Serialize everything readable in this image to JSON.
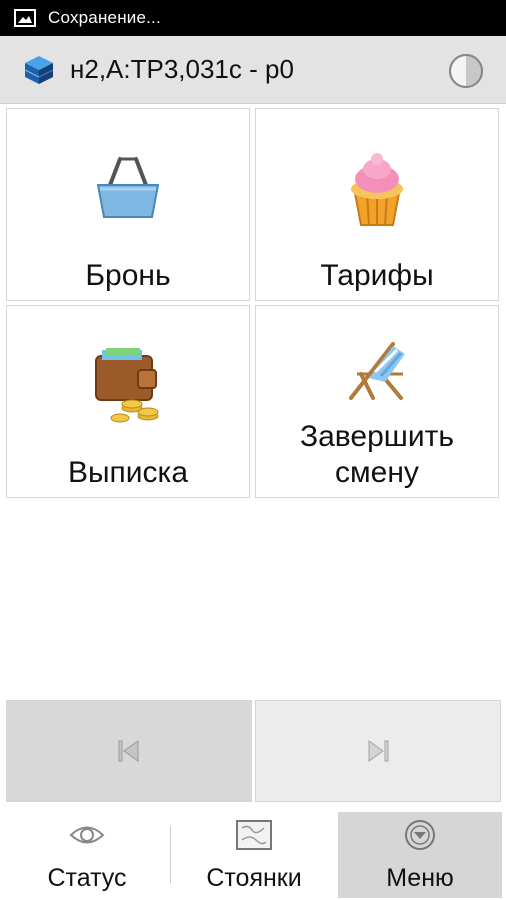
{
  "status_bar": {
    "notification_icon": "image-icon",
    "text": "Сохранение..."
  },
  "action_bar": {
    "app_icon": "layers-cube-icon",
    "title": "н2,А:ТР3,031с - р0",
    "theme_icon": "half-circle-contrast-icon"
  },
  "tiles": [
    {
      "label": "Бронь",
      "icon": "shopping-basket-icon"
    },
    {
      "label": "Тарифы",
      "icon": "cupcake-icon"
    },
    {
      "label": "Выписка",
      "icon": "wallet-coins-icon"
    },
    {
      "label": "Завершить смену",
      "icon": "deck-chair-icon"
    }
  ],
  "pager": {
    "prev_icon": "skip-back-icon",
    "next_icon": "skip-forward-icon"
  },
  "bottom_nav": [
    {
      "label": "Статус",
      "icon": "eye-icon",
      "selected": false
    },
    {
      "label": "Стоянки",
      "icon": "map-icon",
      "selected": false
    },
    {
      "label": "Меню",
      "icon": "circle-down-arrow-icon",
      "selected": true
    }
  ],
  "colors": {
    "selected_nav_bg": "#d6d6d6",
    "action_bar_bg": "#e3e3e3",
    "status_bar_bg": "#000000"
  }
}
